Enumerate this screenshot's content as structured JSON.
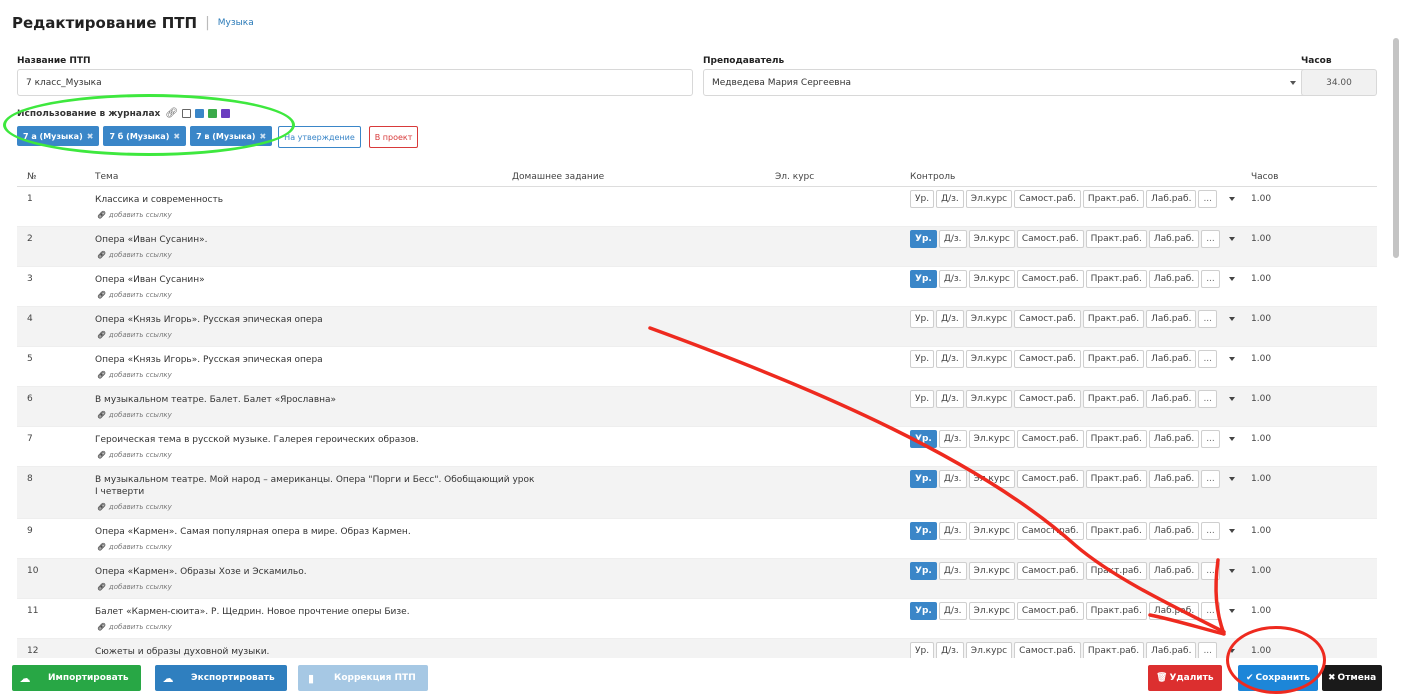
{
  "header": {
    "title": "Редактирование ПТП",
    "subtitle": "Музыка"
  },
  "form": {
    "name_label": "Название ПТП",
    "name_value": "7 класс_Музыка",
    "teacher_label": "Преподаватель",
    "teacher_value": "Медведева Мария Сергеевна",
    "hours_label": "Часов",
    "hours_value": "34.00"
  },
  "journals": {
    "label": "Использование в журналах",
    "squares": [
      "#ffffff",
      "#3a86c8",
      "#3aaa4a",
      "#6a3cc0"
    ],
    "chips": [
      "7 а (Музыка)",
      "7 б (Музыка)",
      "7 в (Музыка)"
    ],
    "approve_label": "На утверждение",
    "project_label": "В проект"
  },
  "table": {
    "columns": {
      "num": "№",
      "topic": "Тема",
      "homework": "Домашнее задание",
      "course": "Эл. курс",
      "control": "Контроль",
      "hours": "Часов"
    },
    "control_labels": [
      "Ур.",
      "Д/з.",
      "Эл.курс",
      "Самост.раб.",
      "Практ.раб.",
      "Лаб.раб.",
      "..."
    ],
    "add_link_label": "добавить ссылку",
    "rows": [
      {
        "num": "1",
        "topic": "Классика и современность",
        "active": false,
        "hours": "1.00"
      },
      {
        "num": "2",
        "topic": "Опера «Иван Сусанин».",
        "active": true,
        "hours": "1.00"
      },
      {
        "num": "3",
        "topic": "Опера «Иван Сусанин»",
        "active": true,
        "hours": "1.00"
      },
      {
        "num": "4",
        "topic": "Опера «Князь Игорь». Русская эпическая опера",
        "active": false,
        "hours": "1.00"
      },
      {
        "num": "5",
        "topic": "Опера «Князь Игорь». Русская эпическая опера",
        "active": false,
        "hours": "1.00"
      },
      {
        "num": "6",
        "topic": "В музыкальном театре. Балет. Балет «Ярославна»",
        "active": false,
        "hours": "1.00"
      },
      {
        "num": "7",
        "topic": "Героическая тема в русской музыке. Галерея героических образов.",
        "active": true,
        "hours": "1.00"
      },
      {
        "num": "8",
        "topic": "В музыкальном театре. Мой народ – американцы. Опера \"Порги и Бесс\". Обобщающий урок I четверти",
        "active": true,
        "hours": "1.00"
      },
      {
        "num": "9",
        "topic": "Опера «Кармен». Самая популярная опера в мире. Образ Кармен.",
        "active": true,
        "hours": "1.00"
      },
      {
        "num": "10",
        "topic": "Опера «Кармен». Образы Хозе и Эскамильо.",
        "active": true,
        "hours": "1.00"
      },
      {
        "num": "11",
        "topic": "Балет «Кармен-сюита». Р. Щедрин. Новое прочтение оперы Бизе.",
        "active": true,
        "hours": "1.00"
      },
      {
        "num": "12",
        "topic": "Сюжеты и образы духовной музыки.",
        "active": false,
        "hours": "1.00"
      }
    ]
  },
  "footer": {
    "import_label": "Импортировать",
    "export_label": "Экспортировать",
    "correction_label": "Коррекция ПТП",
    "delete_label": "Удалить",
    "save_label": "Сохранить",
    "cancel_label": "Отмена"
  },
  "colors": {
    "accent": "#3a86c8",
    "green_annotation": "#3ee83e",
    "red_annotation": "#ee2a1f"
  }
}
